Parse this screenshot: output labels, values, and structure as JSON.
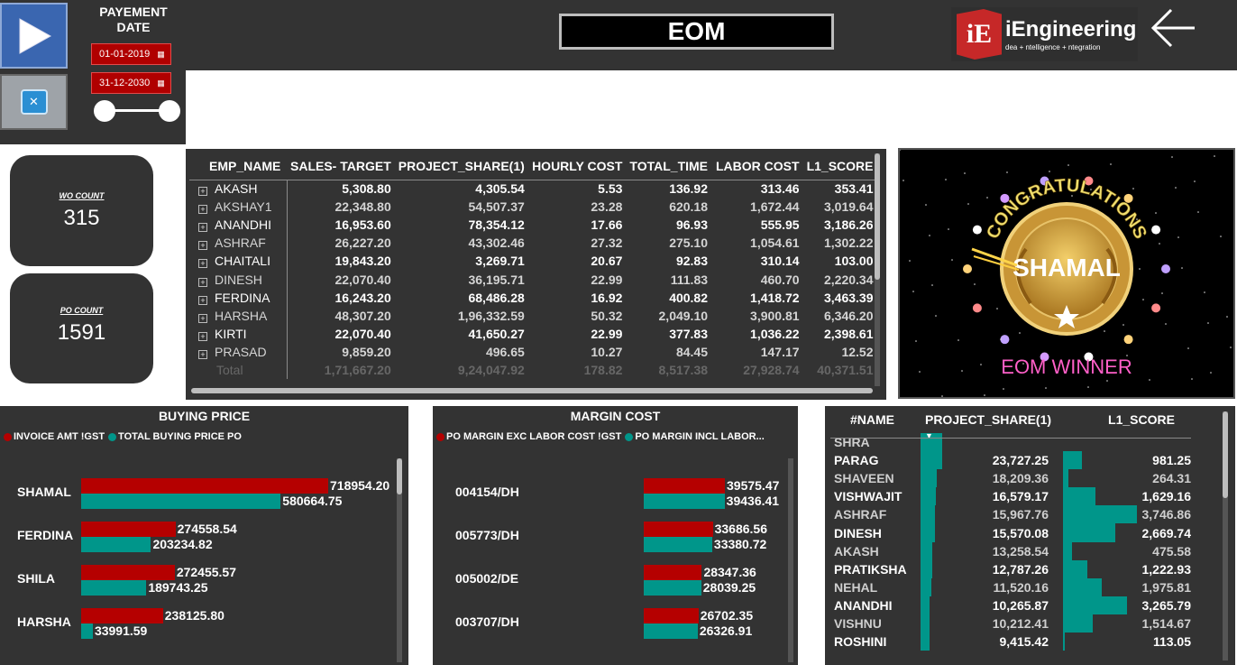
{
  "filter": {
    "title": "PAYEMENT DATE",
    "start_date": "01-01-2019",
    "end_date": "31-12-2030"
  },
  "header": {
    "title": "EOM",
    "logo_title": "iEngineering",
    "logo_subtitle": "dea + ntelligence + ntegration",
    "logo_mark": "iE"
  },
  "kpis": {
    "wo_label": "WO COUNT",
    "wo_value": "315",
    "po_label": "PO COUNT",
    "po_value": "1591"
  },
  "main_table": {
    "columns": [
      "EMP_NAME",
      "SALES- TARGET",
      "PROJECT_SHARE(1)",
      "HOURLY COST",
      "TOTAL_TIME",
      "LABOR COST",
      "L1_SCORE"
    ],
    "rows": [
      [
        "AKASH",
        "5,308.80",
        "4,305.54",
        "5.53",
        "136.92",
        "313.46",
        "353.41"
      ],
      [
        "AKSHAY1",
        "22,348.80",
        "54,507.37",
        "23.28",
        "620.18",
        "1,672.44",
        "3,019.64"
      ],
      [
        "ANANDHI",
        "16,953.60",
        "78,354.12",
        "17.66",
        "96.93",
        "555.95",
        "3,186.26"
      ],
      [
        "ASHRAF",
        "26,227.20",
        "43,302.46",
        "27.32",
        "275.10",
        "1,054.61",
        "1,302.22"
      ],
      [
        "CHAITALI",
        "19,843.20",
        "3,269.71",
        "20.67",
        "92.83",
        "310.14",
        "103.00"
      ],
      [
        "DINESH",
        "22,070.40",
        "36,195.71",
        "22.99",
        "111.83",
        "460.70",
        "2,220.34"
      ],
      [
        "FERDINA",
        "16,243.20",
        "68,486.28",
        "16.92",
        "400.82",
        "1,418.72",
        "3,463.39"
      ],
      [
        "HARSHA",
        "48,307.20",
        "1,96,332.59",
        "50.32",
        "2,049.10",
        "3,900.81",
        "6,346.20"
      ],
      [
        "KIRTI",
        "22,070.40",
        "41,650.27",
        "22.99",
        "377.83",
        "1,036.22",
        "2,398.61"
      ],
      [
        "PRASAD",
        "9,859.20",
        "496.65",
        "10.27",
        "84.45",
        "147.17",
        "12.52"
      ]
    ],
    "total": [
      "Total",
      "1,71,667.20",
      "9,24,047.92",
      "178.82",
      "8,517.38",
      "27,928.74",
      "40,371.51"
    ]
  },
  "winner": {
    "banner": "CONGRATULATIONS",
    "name": "SHAMAL",
    "caption": "EOM WINNER"
  },
  "colors": {
    "red": "#b50000",
    "teal": "#00968a",
    "panel": "#333333"
  },
  "buying_price": {
    "title": "BUYING PRICE",
    "legend": [
      "INVOICE AMT !GST",
      "TOTAL BUYING PRICE PO"
    ],
    "chart_data": {
      "type": "bar",
      "categories": [
        "SHAMAL",
        "FERDINA",
        "SHILA",
        "HARSHA"
      ],
      "series": [
        {
          "name": "INVOICE AMT !GST",
          "values": [
            718954.2,
            274558.54,
            272455.57,
            238125.8
          ]
        },
        {
          "name": "TOTAL BUYING PRICE PO",
          "values": [
            580664.75,
            203234.82,
            189743.25,
            33991.59
          ]
        }
      ],
      "labels": [
        [
          "718954.20",
          "580664.75"
        ],
        [
          "274558.54",
          "203234.82"
        ],
        [
          "272455.57",
          "189743.25"
        ],
        [
          "238125.80",
          "33991.59"
        ]
      ]
    }
  },
  "margin_cost": {
    "title": "MARGIN COST",
    "legend": [
      "PO MARGIN EXC LABOR COST !GST",
      "PO MARGIN INCL LABOR..."
    ],
    "chart_data": {
      "type": "bar",
      "categories": [
        "004154/DH",
        "005773/DH",
        "005002/DE",
        "003707/DH"
      ],
      "series": [
        {
          "name": "PO MARGIN EXC LABOR COST !GST",
          "values": [
            39575.47,
            33686.56,
            28347.36,
            26702.35
          ]
        },
        {
          "name": "PO MARGIN INCL LABOR...",
          "values": [
            39436.41,
            33380.72,
            28039.25,
            26326.91
          ]
        }
      ],
      "labels": [
        [
          "39575.47",
          "39436.41"
        ],
        [
          "33686.56",
          "33380.72"
        ],
        [
          "28347.36",
          "28039.25"
        ],
        [
          "26702.35",
          "26326.91"
        ]
      ]
    }
  },
  "name_table": {
    "columns": [
      "#NAME",
      "PROJECT_SHARE(1)",
      "L1_SCORE"
    ],
    "rows": [
      {
        "name": "SHRA",
        "share": "",
        "score": "",
        "share_v": 23727.25,
        "score_v": 0,
        "dim": true
      },
      {
        "name": "PARAG",
        "share": "23,727.25",
        "score": "981.25",
        "share_v": 23727.25,
        "score_v": 981.25,
        "dim": false
      },
      {
        "name": "SHAVEEN",
        "share": "18,209.36",
        "score": "264.31",
        "share_v": 18209.36,
        "score_v": 264.31,
        "dim": true
      },
      {
        "name": "VISHWAJIT",
        "share": "16,579.17",
        "score": "1,629.16",
        "share_v": 16579.17,
        "score_v": 1629.16,
        "dim": false
      },
      {
        "name": "ASHRAF",
        "share": "15,967.76",
        "score": "3,746.86",
        "share_v": 15967.76,
        "score_v": 3746.86,
        "dim": true
      },
      {
        "name": "DINESH",
        "share": "15,570.08",
        "score": "2,669.74",
        "share_v": 15570.08,
        "score_v": 2669.74,
        "dim": false
      },
      {
        "name": "AKASH",
        "share": "13,258.54",
        "score": "475.58",
        "share_v": 13258.54,
        "score_v": 475.58,
        "dim": true
      },
      {
        "name": "PRATIKSHA",
        "share": "12,787.26",
        "score": "1,222.93",
        "share_v": 12787.26,
        "score_v": 1222.93,
        "dim": false
      },
      {
        "name": "NEHAL",
        "share": "11,520.16",
        "score": "1,975.81",
        "share_v": 11520.16,
        "score_v": 1975.81,
        "dim": true
      },
      {
        "name": "ANANDHI",
        "share": "10,265.87",
        "score": "3,265.79",
        "share_v": 10265.87,
        "score_v": 3265.79,
        "dim": false
      },
      {
        "name": "VISHNU",
        "share": "10,212.41",
        "score": "1,514.67",
        "share_v": 10212.41,
        "score_v": 1514.67,
        "dim": true
      },
      {
        "name": "ROSHINI",
        "share": "9,415.42",
        "score": "113.05",
        "share_v": 9415.42,
        "score_v": 113.05,
        "dim": false
      }
    ]
  }
}
